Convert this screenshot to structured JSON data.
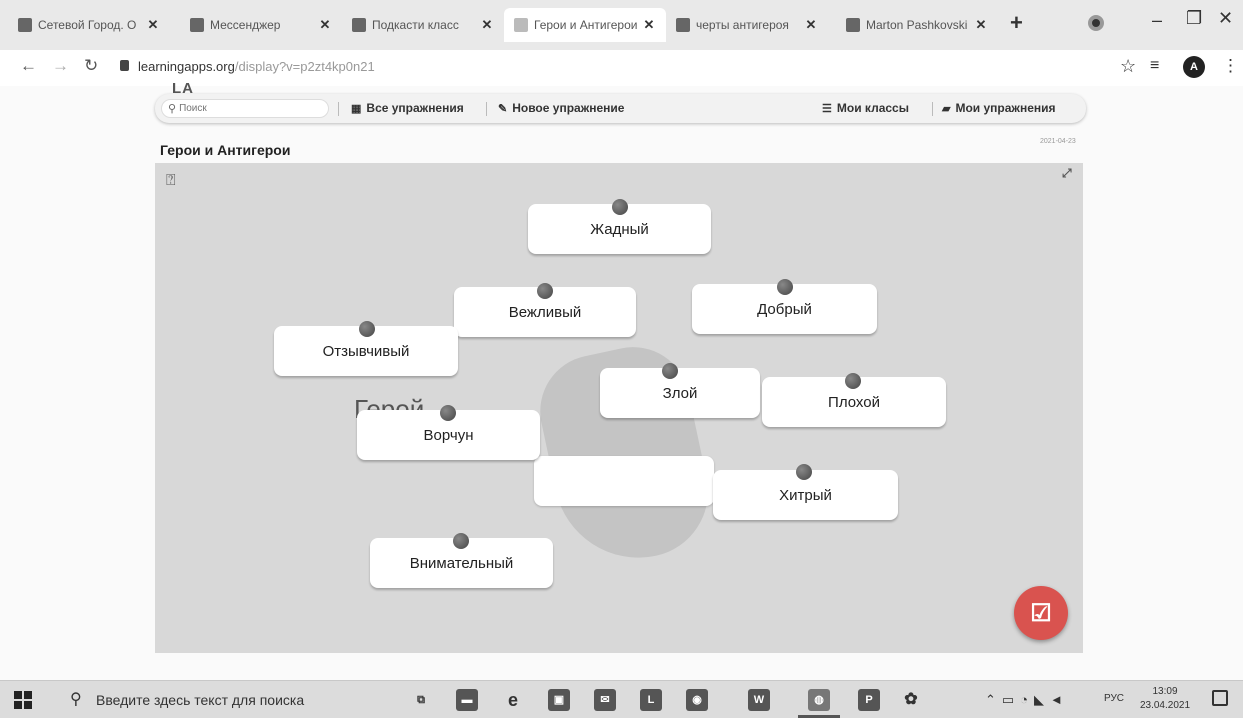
{
  "browser": {
    "tabs": [
      {
        "label": "Сетевой Город. О"
      },
      {
        "label": "Мессенджер"
      },
      {
        "label": "Подкасти класс"
      },
      {
        "label": "Герои и Антигерои"
      },
      {
        "label": "черты антигероя"
      },
      {
        "label": "Marton Pashkovski"
      }
    ],
    "new_tab_label": "+",
    "url_host": "learningapps.org",
    "url_path": "/display?v=p2zt4kp0n21",
    "profile_initial": "A"
  },
  "site": {
    "logo_text": "LA",
    "search_placeholder": "Поиск",
    "nav": {
      "all_exercises": "Все упражнения",
      "new_exercise": "Новое упражнение",
      "my_classes": "Мои классы",
      "my_exercises": "Мои упражнения"
    },
    "page_title": "Герои и Антигерои",
    "page_date": "2021-04-23"
  },
  "exercise": {
    "drop_zone_label": "Герой",
    "cards": [
      {
        "label": "Жадный"
      },
      {
        "label": "Вежливый"
      },
      {
        "label": "Добрый"
      },
      {
        "label": "Отзывчивый"
      },
      {
        "label": "Злой"
      },
      {
        "label": "Плохой"
      },
      {
        "label": "Ворчун"
      },
      {
        "label": "Хитрый"
      },
      {
        "label": "Внимательный"
      }
    ],
    "check_icon": "check-square-icon"
  },
  "taskbar": {
    "search_text": "Введите здесь текст для поиска",
    "apps": [
      {
        "name": "task-view",
        "glyph": "⧉"
      },
      {
        "name": "file-explorer",
        "glyph": "▬"
      },
      {
        "name": "edge",
        "glyph": "e"
      },
      {
        "name": "store",
        "glyph": "▣"
      },
      {
        "name": "mail",
        "glyph": "✉"
      },
      {
        "name": "app-l",
        "glyph": "L"
      },
      {
        "name": "camera",
        "glyph": "◉"
      },
      {
        "name": "word",
        "glyph": "W"
      },
      {
        "name": "chrome",
        "glyph": "◍"
      },
      {
        "name": "app-pd",
        "glyph": "P"
      },
      {
        "name": "settings",
        "glyph": "✿"
      }
    ],
    "language": "РУС",
    "time": "13:09",
    "date": "23.04.2021"
  }
}
